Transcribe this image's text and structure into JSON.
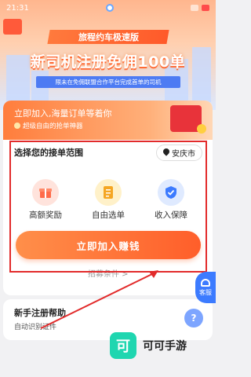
{
  "status_bar": {
    "time": "21:31",
    "icons": [
      "app-dot-icon",
      "notification-icon"
    ]
  },
  "hero": {
    "sub_title": "旅程约车极速版",
    "main_title": "新司机注册免佣100单",
    "note": "限未在免佣联盟合作平台完成首单的司机"
  },
  "card": {
    "head_line1": "立即加入,海量订单等着你",
    "head_line2": "超级自由的抢单神器",
    "range_title": "选择您的接单范围",
    "city": "安庆市",
    "features": [
      {
        "label": "高额奖励",
        "icon": "gift-icon",
        "color": "#ff6b4a"
      },
      {
        "label": "自由选单",
        "icon": "document-icon",
        "color": "#f5a623"
      },
      {
        "label": "收入保障",
        "icon": "shield-check-icon",
        "color": "#3c7bff"
      }
    ],
    "join_button": "立即加入赚钱",
    "recruit_link": "招募条件 >"
  },
  "help": {
    "title": "新手注册帮助",
    "subtitle": "自动识别证件",
    "icon": "question-icon"
  },
  "kefu": {
    "label": "客服"
  },
  "watermark": {
    "logo_text": "可",
    "text": "可可手游"
  },
  "colors": {
    "accent_orange": "#ff6a34",
    "highlight_red": "#e22b2b",
    "brand_blue": "#3c7bff"
  }
}
